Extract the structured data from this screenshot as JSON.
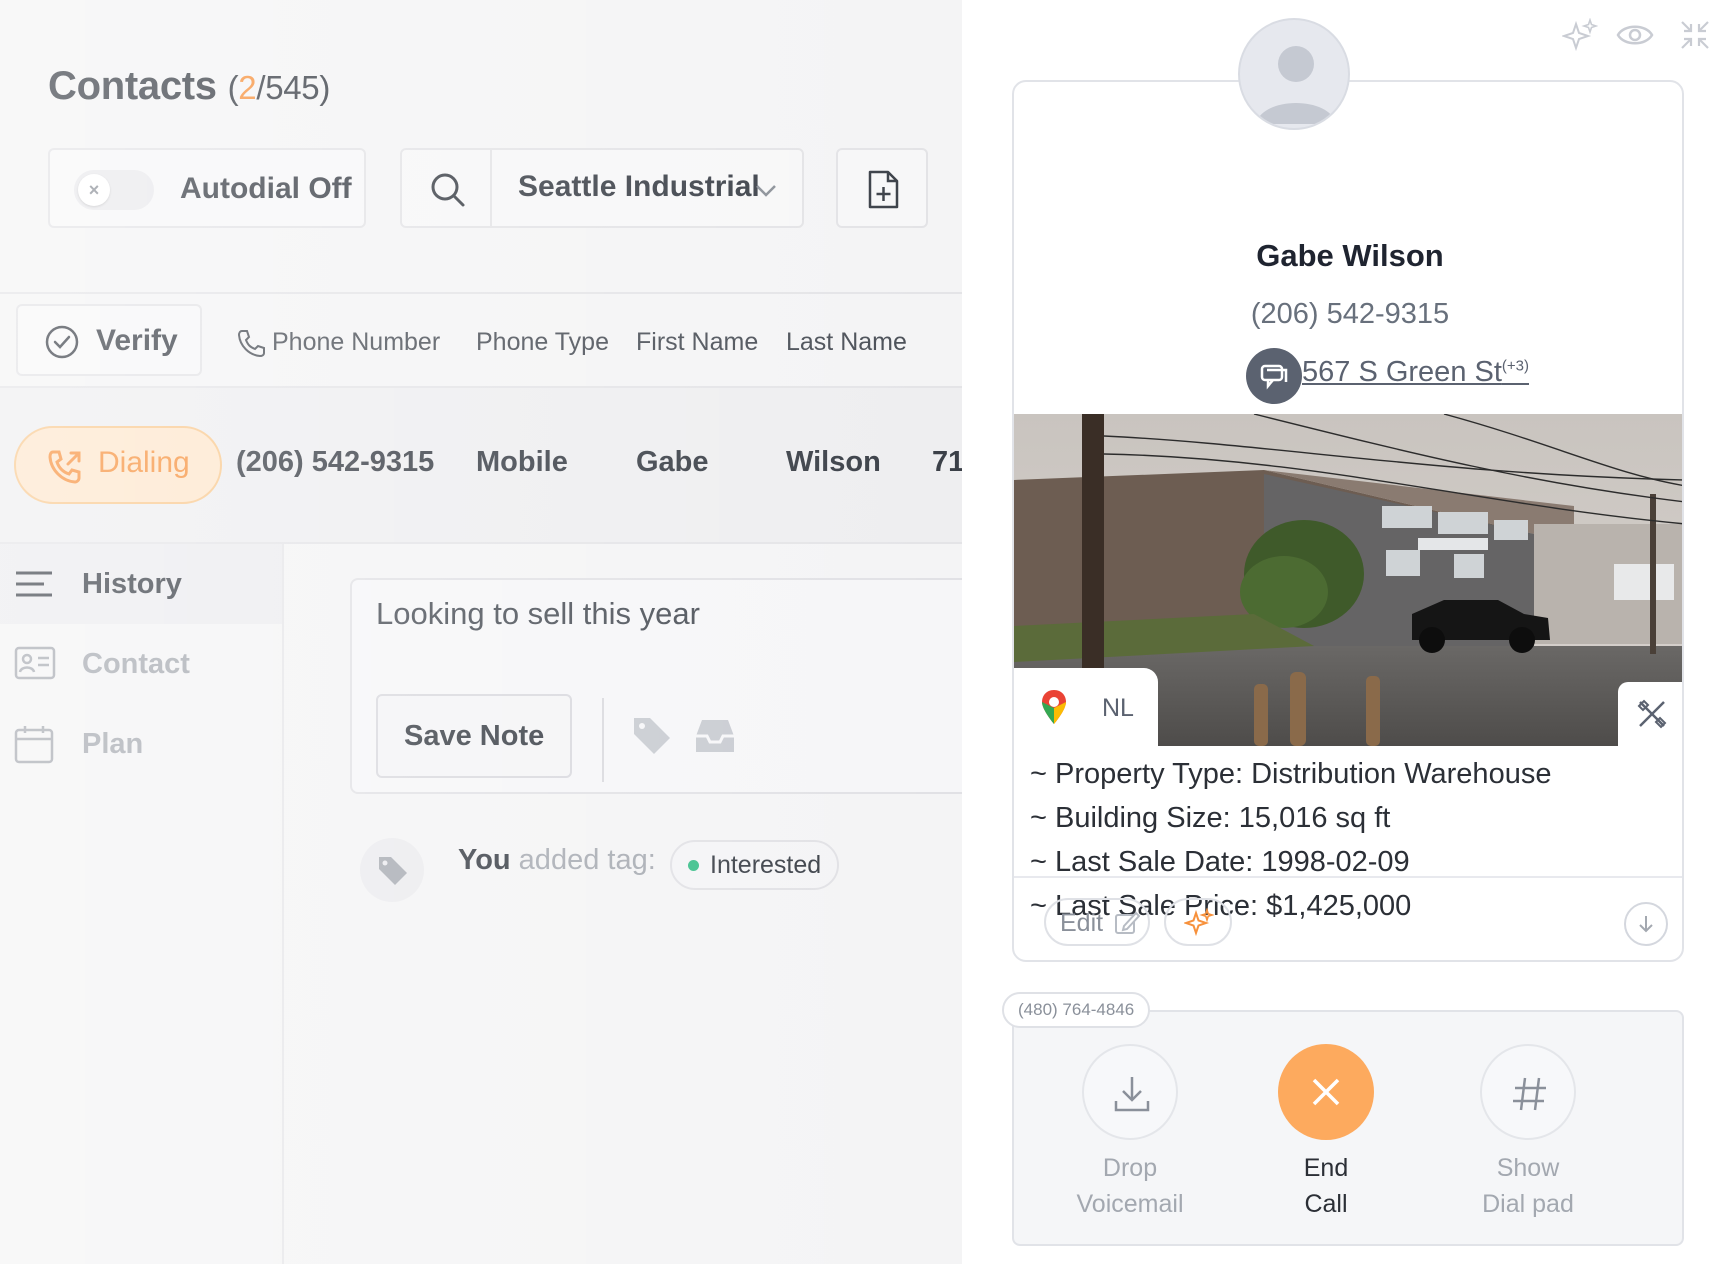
{
  "contacts": {
    "title": "Contacts",
    "count_open": "(",
    "count_selected": "2",
    "count_total": "/545)"
  },
  "toolbar": {
    "autodial_label": "Autodial Off",
    "autodial_on": false,
    "list_name": "Seattle Industrial"
  },
  "table": {
    "verify_label": "Verify",
    "columns": [
      "Phone Number",
      "Phone Type",
      "First Name",
      "Last Name"
    ],
    "active_row": {
      "status": "Dialing",
      "phone": "(206) 542-9315",
      "phone_type": "Mobile",
      "first_name": "Gabe",
      "last_name": "Wilson",
      "next_cell_partial": "71"
    }
  },
  "sidebar": {
    "items": [
      {
        "label": "History",
        "icon": "menu-lines-icon",
        "active": true
      },
      {
        "label": "Contact",
        "icon": "id-card-icon",
        "active": false
      },
      {
        "label": "Plan",
        "icon": "calendar-icon",
        "active": false
      }
    ]
  },
  "note": {
    "text": "Looking to sell this year",
    "save_label": "Save Note"
  },
  "activity": {
    "actor": "You",
    "action": " added tag:",
    "tag": "Interested"
  },
  "contact_card": {
    "name": "Gabe Wilson",
    "phone": "(206) 542-9315",
    "address": "567 S Green St",
    "address_extra": "(+3)",
    "map_label": "NL",
    "properties": [
      "~ Property Type: Distribution Warehouse",
      "~ Building Size: 15,016 sq ft",
      "~ Last Sale Date: 1998-02-09",
      "~ Last Sale Price: $1,425,000"
    ],
    "edit_label": "Edit"
  },
  "call": {
    "caller_id": "(480) 764-4846",
    "buttons": [
      {
        "line1": "Drop",
        "line2": "Voicemail",
        "icon": "download-icon"
      },
      {
        "line1": "End",
        "line2": "Call",
        "icon": "close-icon"
      },
      {
        "line1": "Show",
        "line2": "Dial pad",
        "icon": "hash-icon"
      }
    ]
  },
  "colors": {
    "accent": "#f7913c",
    "end_call": "#fdaa5e",
    "status_green": "#3bbf8a"
  }
}
